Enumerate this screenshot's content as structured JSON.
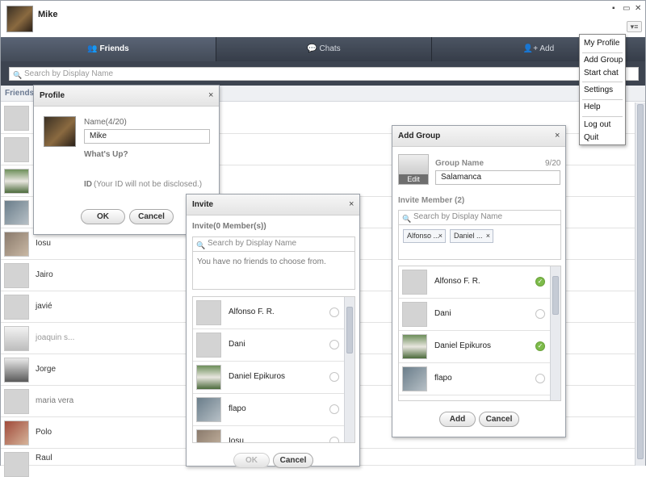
{
  "user": {
    "name": "Mike"
  },
  "window": {
    "minimize": "▪",
    "restore": "▭",
    "close": "✕",
    "menu": "▾≡"
  },
  "tabs": [
    {
      "label": "Friends",
      "icon": "friends-icon"
    },
    {
      "label": "Chats",
      "icon": "chat-icon"
    },
    {
      "label": "Add",
      "icon": "add-user-icon"
    }
  ],
  "search": {
    "placeholder": "Search by Display Name"
  },
  "friends_header": "Friends (",
  "friends": [
    {
      "name": ""
    },
    {
      "name": ""
    },
    {
      "name": ""
    },
    {
      "name": ""
    },
    {
      "name": "Iosu"
    },
    {
      "name": "Jairo"
    },
    {
      "name": "javié"
    },
    {
      "name": "joaquin s..."
    },
    {
      "name": "Jorge"
    },
    {
      "name": "maria vera"
    },
    {
      "name": "Polo"
    },
    {
      "name": "Raul"
    }
  ],
  "menu": {
    "items": [
      "My Profile",
      "Add Group",
      "Start chat",
      "Settings",
      "Help",
      "Log out",
      "Quit"
    ]
  },
  "profile_dialog": {
    "title": "Profile",
    "close": "×",
    "name_label": "Name(4/20)",
    "name_value": "Mike",
    "status_label": "What's Up?",
    "id_label": "ID",
    "id_note": "(Your ID will not be disclosed.)",
    "ok": "OK",
    "cancel": "Cancel"
  },
  "invite_dialog": {
    "title": "Invite",
    "close": "×",
    "members_label": "Invite(0  Member(s))",
    "search_placeholder": "Search by Display Name",
    "empty_message": "You have no friends to choose from.",
    "list": [
      {
        "name": "Alfonso F. R."
      },
      {
        "name": "Dani"
      },
      {
        "name": "Daniel Epikuros"
      },
      {
        "name": "flapo"
      },
      {
        "name": "Iosu"
      }
    ],
    "ok": "OK",
    "cancel": "Cancel"
  },
  "add_group_dialog": {
    "title": "Add Group",
    "close": "×",
    "edit_label": "Edit",
    "group_name_label": "Group Name",
    "group_name_count": "9/20",
    "group_name_value": "Salamanca",
    "invite_label": "Invite Member (2)",
    "search_placeholder": "Search by Display Name",
    "chips": [
      "Alfonso ...",
      "Daniel ..."
    ],
    "chip_remove": "×",
    "check": "✓",
    "list": [
      {
        "name": "Alfonso F. R.",
        "selected": true
      },
      {
        "name": "Dani",
        "selected": false
      },
      {
        "name": "Daniel Epikuros",
        "selected": true
      },
      {
        "name": "flapo",
        "selected": false
      }
    ],
    "add": "Add",
    "cancel": "Cancel"
  },
  "colors": {
    "accent": "#6b7a92",
    "tabbar": "#3d4450",
    "check": "#7dbb4a"
  }
}
